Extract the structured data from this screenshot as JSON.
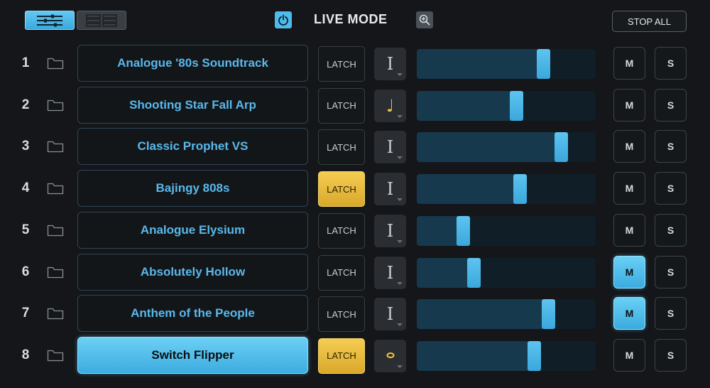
{
  "header": {
    "title": "LIVE MODE",
    "stop_all_label": "STOP ALL",
    "view_toggle": [
      {
        "icon": "mixer-sliders-icon",
        "active": true
      },
      {
        "icon": "grid-view-icon",
        "active": false
      }
    ],
    "power_icon": "power-icon",
    "zoom_icon": "zoom-in-icon"
  },
  "colors": {
    "accent_blue": "#4dbbec",
    "latch_yellow": "#f0c33c",
    "track_text_blue": "#5ab8ec"
  },
  "tracks": [
    {
      "number": "1",
      "name": "Analogue '80s Soundtrack",
      "latch_label": "LATCH",
      "latch_on": false,
      "mode_icon": "bar-icon",
      "mode_glyph": "I",
      "level": 0.71,
      "mute_label": "M",
      "solo_label": "S",
      "mute_on": false,
      "selected": false
    },
    {
      "number": "2",
      "name": "Shooting Star Fall Arp",
      "latch_label": "LATCH",
      "latch_on": false,
      "mode_icon": "note-icon",
      "mode_glyph": "♩",
      "level": 0.56,
      "mute_label": "M",
      "solo_label": "S",
      "mute_on": false,
      "selected": false
    },
    {
      "number": "3",
      "name": "Classic Prophet VS",
      "latch_label": "LATCH",
      "latch_on": false,
      "mode_icon": "bar-icon",
      "mode_glyph": "I",
      "level": 0.81,
      "mute_label": "M",
      "solo_label": "S",
      "mute_on": false,
      "selected": false
    },
    {
      "number": "4",
      "name": "Bajingy 808s",
      "latch_label": "LATCH",
      "latch_on": true,
      "mode_icon": "bar-icon",
      "mode_glyph": "I",
      "level": 0.58,
      "mute_label": "M",
      "solo_label": "S",
      "mute_on": false,
      "selected": false
    },
    {
      "number": "5",
      "name": "Analogue Elysium",
      "latch_label": "LATCH",
      "latch_on": false,
      "mode_icon": "bar-icon",
      "mode_glyph": "I",
      "level": 0.26,
      "mute_label": "M",
      "solo_label": "S",
      "mute_on": false,
      "selected": false
    },
    {
      "number": "6",
      "name": "Absolutely Hollow",
      "latch_label": "LATCH",
      "latch_on": false,
      "mode_icon": "bar-icon",
      "mode_glyph": "I",
      "level": 0.32,
      "mute_label": "M",
      "solo_label": "S",
      "mute_on": true,
      "selected": false
    },
    {
      "number": "7",
      "name": "Anthem of the People",
      "latch_label": "LATCH",
      "latch_on": false,
      "mode_icon": "bar-icon",
      "mode_glyph": "I",
      "level": 0.74,
      "mute_label": "M",
      "solo_label": "S",
      "mute_on": true,
      "selected": false
    },
    {
      "number": "8",
      "name": "Switch Flipper",
      "latch_label": "LATCH",
      "latch_on": true,
      "mode_icon": "loop-icon",
      "mode_glyph": "",
      "level": 0.66,
      "mute_label": "M",
      "solo_label": "S",
      "mute_on": false,
      "selected": true
    }
  ]
}
